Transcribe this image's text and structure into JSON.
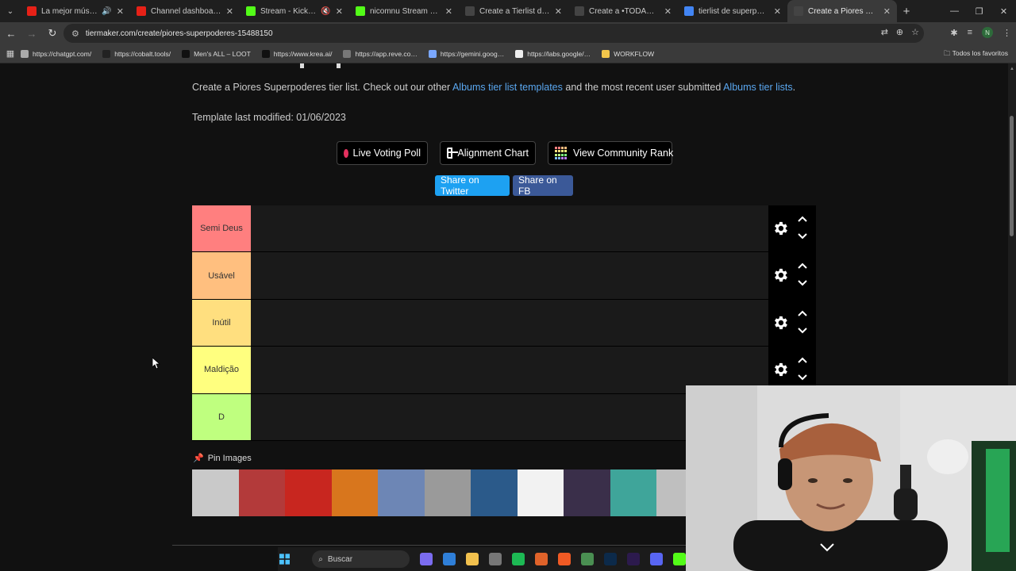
{
  "browser": {
    "tabs": [
      {
        "title": "La mejor música de el…",
        "color": "#e62117",
        "icon": "youtube-icon",
        "extra": "🔊"
      },
      {
        "title": "Channel dashboard - You…",
        "color": "#e62117",
        "icon": "youtube-icon",
        "extra": ""
      },
      {
        "title": "Stream - Kick Dashbo…",
        "color": "#53fc18",
        "icon": "kick-icon",
        "extra": "🔇"
      },
      {
        "title": "nicomnu Stream - Wa…",
        "color": "#53fc18",
        "icon": "kick-icon",
        "extra": ""
      },
      {
        "title": "Create a Tierlist de vicios…",
        "color": "#444444",
        "icon": "tiermaker-icon",
        "extra": ""
      },
      {
        "title": "Create a •TODAS LAS CA…",
        "color": "#444444",
        "icon": "tiermaker-icon",
        "extra": ""
      },
      {
        "title": "tierlist de superpoderes…",
        "color": "#4285f4",
        "icon": "google-icon",
        "extra": ""
      },
      {
        "title": "Create a Piores Superpod…",
        "color": "#444444",
        "icon": "tiermaker-icon",
        "extra": ""
      }
    ],
    "url": "tiermaker.com/create/piores-superpoderes-15488150",
    "bookmarks": [
      {
        "label": "https://chatgpt.com/",
        "color": "#aaaaaa"
      },
      {
        "label": "https://cobalt.tools/",
        "color": "#222222"
      },
      {
        "label": "Men's ALL – LOOT",
        "color": "#111111"
      },
      {
        "label": "https://www.krea.ai/",
        "color": "#111111"
      },
      {
        "label": "https://app.reve.co…",
        "color": "#777777"
      },
      {
        "label": "https://gemini.goog…",
        "color": "#7aa7ff"
      },
      {
        "label": "https://labs.google/…",
        "color": "#eeeeee"
      },
      {
        "label": "WORKFLOW",
        "color": "#f3c64b"
      }
    ],
    "all_bookmarks": "Todos los favoritos",
    "profile_initial": "N"
  },
  "page": {
    "intro_pre": "Create a Piores Superpoderes tier list. Check out our other ",
    "intro_link1": "Albums tier list templates",
    "intro_mid": " and the most recent user submitted ",
    "intro_link2": "Albums tier lists",
    "intro_end": ".",
    "modified": "Template last modified: 01/06/2023",
    "buttons": {
      "live_poll": "Live Voting Poll",
      "alignment": "Alignment Chart",
      "community": "View Community Rank"
    },
    "share_twitter": "Share on Twitter",
    "share_fb": "Share on FB",
    "tiers": [
      {
        "label": "Semi Deus",
        "color": "#ff7f7f"
      },
      {
        "label": "Usável",
        "color": "#ffbf7f"
      },
      {
        "label": "Inútil",
        "color": "#ffdf7f"
      },
      {
        "label": "Maldição",
        "color": "#ffff7f"
      },
      {
        "label": "D",
        "color": "#bfff7f"
      }
    ],
    "pin_label": "Pin Images",
    "thumbnails": [
      "#c9c9c9",
      "#b33a3a",
      "#c8261f",
      "#d8761d",
      "#6d86b5",
      "#9a9a9a",
      "#2b5a8a",
      "#f2f2f2",
      "#3a2f4a",
      "#3fa59a",
      "#bfbfbf"
    ]
  },
  "taskbar": {
    "search": "Buscar",
    "apps": [
      {
        "name": "copilot-icon",
        "color": "#7b6cf0"
      },
      {
        "name": "mail-icon",
        "color": "#2f7fd8"
      },
      {
        "name": "explorer-icon",
        "color": "#f2c14e"
      },
      {
        "name": "chrome-icon",
        "color": "#777777"
      },
      {
        "name": "spotify-icon",
        "color": "#1db954"
      },
      {
        "name": "firefox-icon",
        "color": "#e0632a"
      },
      {
        "name": "brave-icon",
        "color": "#f05a24"
      },
      {
        "name": "chrome-active-icon",
        "color": "#4a8f52"
      },
      {
        "name": "photoshop-icon",
        "color": "#0c2a4a"
      },
      {
        "name": "premiere-icon",
        "color": "#2c1a4d"
      },
      {
        "name": "discord-icon",
        "color": "#5865f2"
      },
      {
        "name": "kick-app-icon",
        "color": "#53fc18"
      }
    ]
  }
}
